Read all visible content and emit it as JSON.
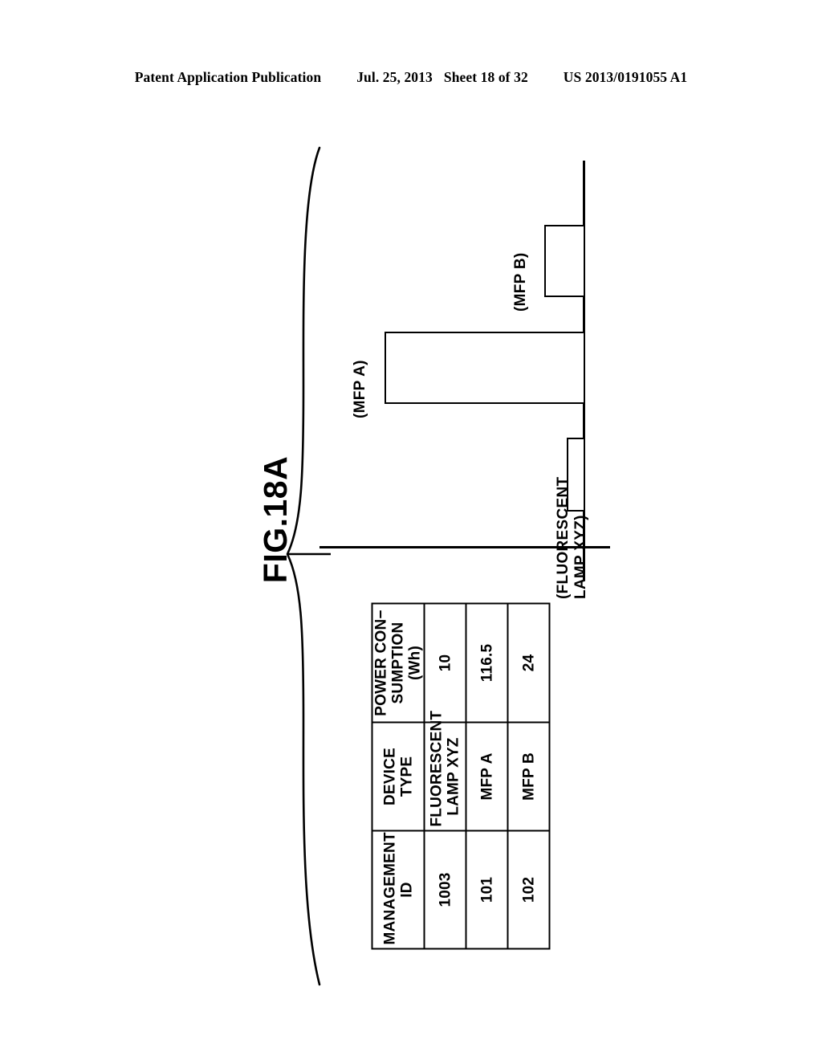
{
  "page_header": {
    "publication": "Patent Application Publication",
    "date": "Jul. 25, 2013",
    "sheet": "Sheet 18 of 32",
    "publication_number": "US 2013/0191055 A1"
  },
  "figure": {
    "label": "FIG.18A"
  },
  "chart_data": {
    "type": "bar",
    "orientation": "horizontal",
    "title": "FIG.18A",
    "categories": [
      "(MFP B)",
      "(MFP A)",
      "(FLUORESCENT LAMP XYZ)"
    ],
    "values": [
      24,
      116.5,
      10
    ],
    "xlabel": "",
    "ylabel": "",
    "xlim": [
      0,
      130
    ],
    "grid": false,
    "legend": "none",
    "bars": [
      {
        "label": "(MFP B)",
        "value": 24
      },
      {
        "label": "(MFP A)",
        "value": 116.5
      },
      {
        "label_line1": "(FLUORESCENT",
        "label_line2": "LAMP XYZ)",
        "label": "(FLUORESCENT LAMP XYZ)",
        "value": 10
      }
    ]
  },
  "table": {
    "headers": [
      "MANAGEMENT ID",
      "DEVICE TYPE",
      "POWER CON- SUMPTION (Wh)"
    ],
    "headers_wrapped": [
      {
        "line1": "MANAGEMENT",
        "line2": "ID"
      },
      {
        "line1": "DEVICE",
        "line2": "TYPE"
      },
      {
        "line1": "POWER CON−",
        "line2": "SUMPTION (Wh)"
      }
    ],
    "rows": [
      {
        "management_id": "1003",
        "device_type_line1": "FLUORESCENT",
        "device_type_line2": "LAMP XYZ",
        "device_type": "FLUORESCENT LAMP XYZ",
        "power_consumption": "10"
      },
      {
        "management_id": "101",
        "device_type_line1": "MFP A",
        "device_type_line2": "",
        "device_type": "MFP A",
        "power_consumption": "116.5"
      },
      {
        "management_id": "102",
        "device_type_line1": "MFP B",
        "device_type_line2": "",
        "device_type": "MFP B",
        "power_consumption": "24"
      }
    ]
  },
  "colors": {
    "ink": "#000000",
    "paper": "#ffffff"
  }
}
